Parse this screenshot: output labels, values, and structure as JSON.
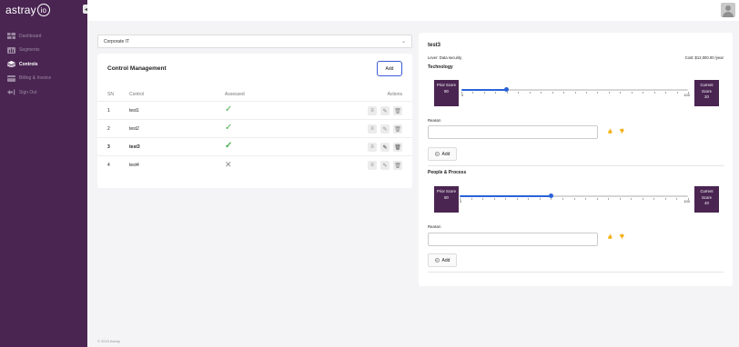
{
  "app": {
    "logo_text": "astray",
    "logo_ring": "io"
  },
  "sidebar": {
    "items": [
      {
        "label": "Dashboard",
        "icon": "dashboard-icon",
        "active": false
      },
      {
        "label": "Segments",
        "icon": "segments-icon",
        "active": false
      },
      {
        "label": "Controls",
        "icon": "layers-icon",
        "active": true
      },
      {
        "label": "Billing & Invoice",
        "icon": "card-icon",
        "active": false
      },
      {
        "label": "Sign Out",
        "icon": "sign-out-icon",
        "active": false
      }
    ]
  },
  "left": {
    "select_value": "Corporate IT",
    "title": "Control Management",
    "add_label": "Add",
    "columns": {
      "sn": "SN",
      "control": "Control",
      "assessed": "Assessed",
      "actions": "Actions"
    },
    "rows": [
      {
        "sn": "1",
        "control": "test1",
        "assessed": true
      },
      {
        "sn": "2",
        "control": "test2",
        "assessed": true
      },
      {
        "sn": "3",
        "control": "test3",
        "assessed": true
      },
      {
        "sn": "4",
        "control": "test4",
        "assessed": false
      }
    ]
  },
  "right": {
    "control_name": "test3",
    "lever": "Lever: Data security",
    "cost": "Cost: $12,000.00 /year",
    "sections": [
      {
        "title": "Technology",
        "prior_label": "Prior Score",
        "prior_score": "80",
        "current_label_1": "Current",
        "current_label_2": "Score",
        "current_score": "20",
        "slider_value": 20,
        "min": "0",
        "max": "100",
        "reason_label": "Reason",
        "add_label": "Add"
      },
      {
        "title": "People & Process",
        "prior_label": "Prior Score",
        "prior_score": "80",
        "current_label_1": "Current",
        "current_label_2": "Score",
        "current_score": "40",
        "slider_value": 40,
        "min": "0",
        "max": "100",
        "reason_label": "Reason",
        "add_label": "Add"
      }
    ]
  },
  "footer": {
    "text": "© 2023 Astray"
  },
  "colors": {
    "sidebar": "#4a2552",
    "accent": "#2962d9",
    "check": "#4caf50"
  }
}
